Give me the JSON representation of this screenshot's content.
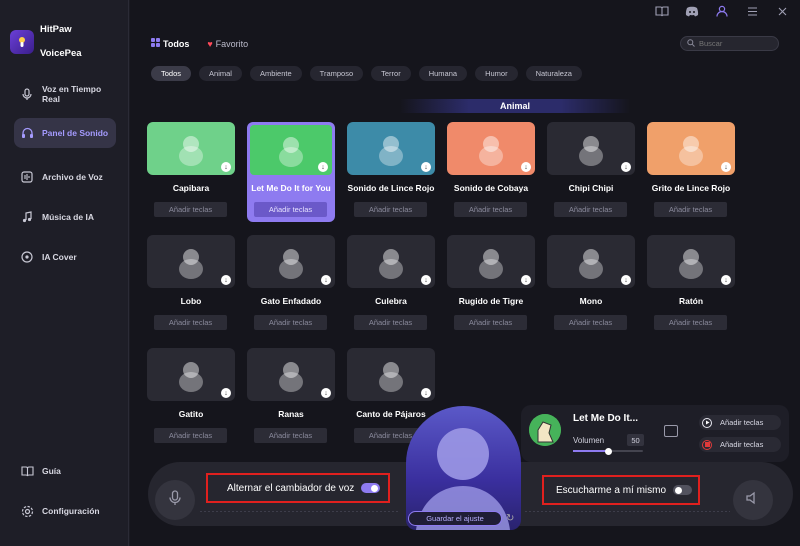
{
  "app": {
    "name_line1": "HitPaw",
    "name_line2": "VoicePea"
  },
  "sidebar": {
    "items": [
      {
        "label": "Voz en Tiempo Real",
        "icon": "microphone-icon",
        "active": false
      },
      {
        "label": "Panel de Sonido",
        "icon": "headphones-icon",
        "active": true
      },
      {
        "label": "Archivo de Voz",
        "icon": "voice-file-icon",
        "active": false
      },
      {
        "label": "Música de IA",
        "icon": "music-ai-icon",
        "active": false
      },
      {
        "label": "IA Cover",
        "icon": "cover-icon",
        "active": false
      }
    ],
    "footer": [
      {
        "label": "Guía",
        "icon": "book-icon"
      },
      {
        "label": "Configuración",
        "icon": "gear-icon"
      }
    ]
  },
  "topbar": {
    "icons": [
      "book-icon",
      "discord-icon",
      "user-icon",
      "menu-icon",
      "close-icon"
    ]
  },
  "tabs": [
    {
      "label": "Todos",
      "active": true
    },
    {
      "label": "Favorito",
      "active": false
    }
  ],
  "search": {
    "placeholder": "Buscar"
  },
  "filters": [
    "Todos",
    "Animal",
    "Ambiente",
    "Tramposo",
    "Terror",
    "Humana",
    "Humor",
    "Naturaleza"
  ],
  "section_title": "Animal",
  "add_keys_label": "Añadir teclas",
  "cards": [
    {
      "name": "Capibara",
      "color": "#6fd18a"
    },
    {
      "name": "Let Me Do It for You",
      "color": "#4cc96a",
      "active": true
    },
    {
      "name": "Sonido de Lince Rojo",
      "color": "#3d8ba8"
    },
    {
      "name": "Sonido de Cobaya",
      "color": "#f08a6a"
    },
    {
      "name": "Chipi Chipi",
      "color": "#2a2a33"
    },
    {
      "name": "Grito de Lince Rojo",
      "color": "#f0a06a"
    },
    {
      "name": "Lobo",
      "color": "#2a2a33"
    },
    {
      "name": "Gato Enfadado",
      "color": "#2a2a33"
    },
    {
      "name": "Culebra",
      "color": "#2a2a33"
    },
    {
      "name": "Rugido de Tigre",
      "color": "#2a2a33"
    },
    {
      "name": "Mono",
      "color": "#2a2a33"
    },
    {
      "name": "Ratón",
      "color": "#2a2a33"
    },
    {
      "name": "Gatito",
      "color": "#2a2a33"
    },
    {
      "name": "Ranas",
      "color": "#2a2a33"
    },
    {
      "name": "Canto de Pájaros",
      "color": "#2a2a33"
    }
  ],
  "controls": {
    "voice_changer_label": "Alternar el cambiador de voz",
    "voice_changer_on": true,
    "listen_label": "Escucharme a mí mismo",
    "listen_on": false,
    "save_label": "Guardar el ajuste"
  },
  "now_playing": {
    "title": "Let Me Do It...",
    "volume_label": "Volumen",
    "volume_value": "50",
    "volume_fraction": 0.5,
    "play_keys_label": "Añadir teclas",
    "stop_keys_label": "Añadir teclas"
  },
  "colors": {
    "accent": "#8e7bf0",
    "highlight_border": "#e0201e"
  }
}
